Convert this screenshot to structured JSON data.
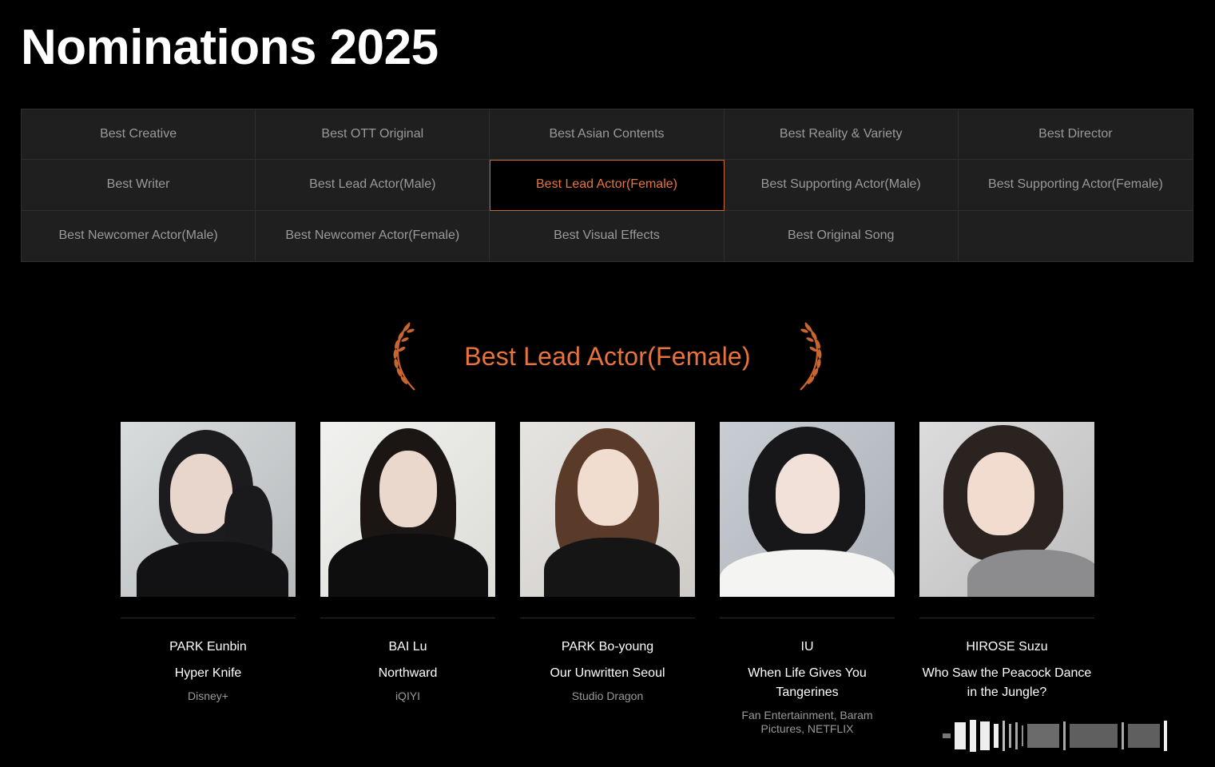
{
  "page": {
    "title": "Nominations 2025"
  },
  "tabs": [
    {
      "label": "Best Creative"
    },
    {
      "label": "Best OTT Original"
    },
    {
      "label": "Best Asian Contents"
    },
    {
      "label": "Best Reality & Variety"
    },
    {
      "label": "Best Director"
    },
    {
      "label": "Best Writer"
    },
    {
      "label": "Best Lead Actor(Male)"
    },
    {
      "label": "Best Lead Actor(Female)",
      "active": true
    },
    {
      "label": "Best Supporting Actor(Male)"
    },
    {
      "label": "Best Supporting Actor(Female)"
    },
    {
      "label": "Best Newcomer Actor(Male)"
    },
    {
      "label": "Best Newcomer Actor(Female)"
    },
    {
      "label": "Best Visual Effects"
    },
    {
      "label": "Best Original Song"
    },
    {
      "label": ""
    }
  ],
  "category": {
    "title": "Best Lead Actor(Female)",
    "icon": "laurel-icon"
  },
  "nominees": [
    {
      "name": "PARK Eunbin",
      "work": "Hyper Knife",
      "company": "Disney+"
    },
    {
      "name": "BAI Lu",
      "work": "Northward",
      "company": "iQIYI"
    },
    {
      "name": "PARK Bo-young",
      "work": "Our Unwritten Seoul",
      "company": "Studio Dragon"
    },
    {
      "name": "IU",
      "work": "When Life Gives You Tangerines",
      "company": "Fan Entertainment, Baram Pictures, NETFLIX"
    },
    {
      "name": "HIROSE Suzu",
      "work": "Who Saw the Peacock Dance in the Jungle?",
      "company": ""
    }
  ],
  "colors": {
    "accent": "#e8743b",
    "background": "#000000",
    "tab_bg": "#1f1f1f",
    "muted_text": "#9a9a9a"
  }
}
